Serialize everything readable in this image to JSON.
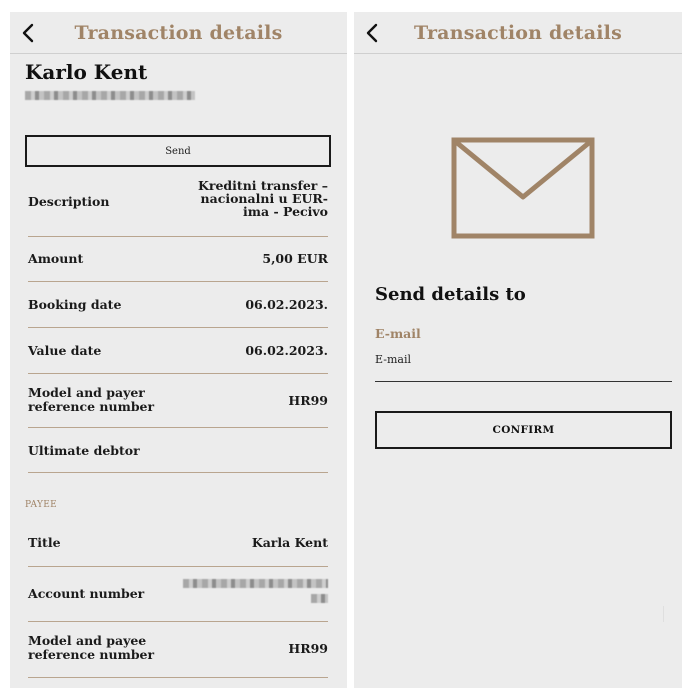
{
  "left": {
    "header": {
      "title": "Transaction details",
      "back_icon": "chevron-left-icon"
    },
    "payer_name": "Karlo Kent",
    "send_label": "Send",
    "rows": [
      {
        "label": "Description",
        "value": "Kreditni transfer – nacionalni u EUR-ima - Pecivo"
      },
      {
        "label": "Amount",
        "value": "5,00 EUR"
      },
      {
        "label": "Booking date",
        "value": "06.02.2023."
      },
      {
        "label": "Value date",
        "value": "06.02.2023."
      },
      {
        "label": "Model and payer reference number",
        "value": "HR99"
      },
      {
        "label": "Ultimate debtor",
        "value": ""
      }
    ],
    "payee_section_label": "PAYEE",
    "payee_rows": [
      {
        "label": "Title",
        "value": "Karla Kent"
      },
      {
        "label": "Account number",
        "value": ""
      },
      {
        "label": "Model and payee reference number",
        "value": "HR99"
      }
    ]
  },
  "right": {
    "header": {
      "title": "Transaction details",
      "back_icon": "chevron-left-icon"
    },
    "envelope_icon": "envelope-icon",
    "send_details_title": "Send details to",
    "email_label": "E-mail",
    "email_placeholder": "E-mail",
    "email_value": "",
    "confirm_label": "CONFIRM"
  },
  "colors": {
    "accent": "#a08467",
    "background": "#ececec",
    "divider": "#b9a58f",
    "text": "#1a1a1a"
  }
}
